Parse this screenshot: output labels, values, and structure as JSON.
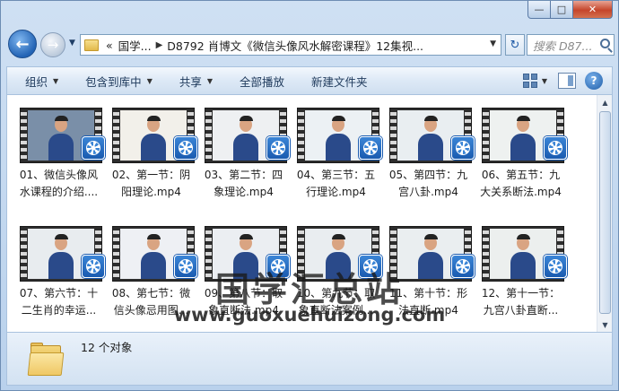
{
  "window": {
    "caption_buttons": {
      "minimize": "—",
      "maximize": "□",
      "close": "✕"
    }
  },
  "nav": {
    "back_glyph": "←",
    "forward_glyph": "→",
    "address_parts": [
      "«",
      "国学...",
      "D8792 肖博文《微信头像风水解密课程》12集视..."
    ],
    "refresh_glyph": "↻",
    "search_placeholder": "搜索 D87..."
  },
  "toolbar": {
    "items": [
      {
        "label": "组织",
        "dropdown": true
      },
      {
        "label": "包含到库中",
        "dropdown": true
      },
      {
        "label": "共享",
        "dropdown": true
      },
      {
        "label": "全部播放",
        "dropdown": false
      },
      {
        "label": "新建文件夹",
        "dropdown": false
      }
    ],
    "help_glyph": "?"
  },
  "files": [
    {
      "line1": "01、微信头像风",
      "line2": "水课程的介绍....",
      "bg": "#7a8fa8"
    },
    {
      "line1": "02、第一节：阴",
      "line2": "阳理论.mp4",
      "bg": "#f2f0ea"
    },
    {
      "line1": "03、第二节：四",
      "line2": "象理论.mp4",
      "bg": "#eef0f2"
    },
    {
      "line1": "04、第三节：五",
      "line2": "行理论.mp4",
      "bg": "#ecf1f4"
    },
    {
      "line1": "05、第四节：九",
      "line2": "宫八卦.mp4",
      "bg": "#e9eef1"
    },
    {
      "line1": "06、第五节：九",
      "line2": "大关系断法.mp4",
      "bg": "#eef1f0"
    },
    {
      "line1": "07、第六节：十",
      "line2": "二生肖的幸运...",
      "bg": "#e8ecef"
    },
    {
      "line1": "08、第七节：微",
      "line2": "信头像忌用图...",
      "bg": "#eef0f4"
    },
    {
      "line1": "09、第八节：取",
      "line2": "象直断法.mp4",
      "bg": "#ebeef2"
    },
    {
      "line1": "10、第九节：取",
      "line2": "象直断法案例...",
      "bg": "#e9edf0"
    },
    {
      "line1": "11、第十节：形",
      "line2": "法直断.mp4",
      "bg": "#eaeef0"
    },
    {
      "line1": "12、第十一节：",
      "line2": "九宫八卦直断...",
      "bg": "#ecefee"
    }
  ],
  "watermark": {
    "title": "国学汇总站",
    "url": "www.guoxuehuizong.com"
  },
  "scrollbar": {
    "up": "▲",
    "down": "▼"
  },
  "details": {
    "count": "12 个对象"
  }
}
